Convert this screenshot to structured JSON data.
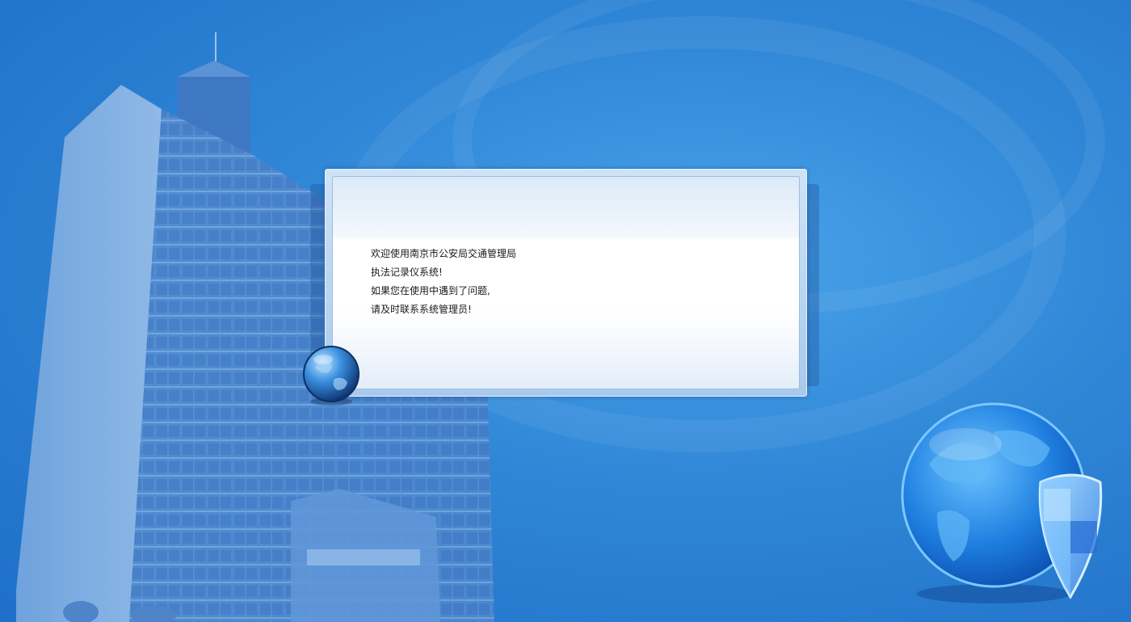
{
  "message": {
    "lines": [
      "欢迎使用南京市公安局交通管理局",
      "执法记录仪系统!",
      "如果您在使用中遇到了问题,",
      "请及时联系系统管理员!"
    ]
  },
  "icons": {
    "small_globe": "globe-icon",
    "large_globe": "globe-shield-icon"
  },
  "colors": {
    "background": "#2f86d6",
    "dialog_border": "#a8c9ec",
    "text": "#1a1a1a"
  }
}
